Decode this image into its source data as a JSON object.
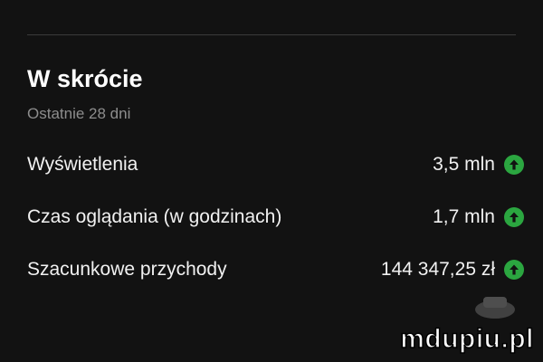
{
  "header": {
    "title": "W skrócie",
    "subtitle": "Ostatnie 28 dni"
  },
  "metrics": [
    {
      "label": "Wyświetlenia",
      "value": "3,5 mln",
      "trend_icon": "arrow-up-circle-icon"
    },
    {
      "label": "Czas oglądania (w godzinach)",
      "value": "1,7 mln",
      "trend_icon": "arrow-up-circle-icon"
    },
    {
      "label": "Szacunkowe przychody",
      "value": "144 347,25 zł",
      "trend_icon": "arrow-up-circle-icon"
    }
  ],
  "watermark": {
    "text": "mdupiu.pl"
  },
  "colors": {
    "background": "#121212",
    "text": "#f1f1f1",
    "subtitle": "#8d8d8d",
    "trend_up": "#2ba640",
    "divider": "#3b3b3b"
  }
}
